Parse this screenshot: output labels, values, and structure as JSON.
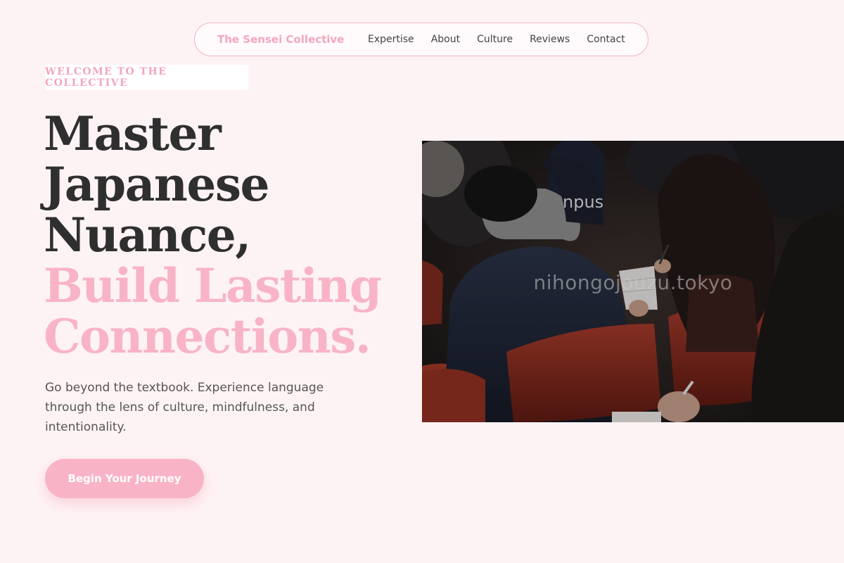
{
  "nav": {
    "brand": "The Sensei Collective",
    "links": [
      "Expertise",
      "About",
      "Culture",
      "Reviews",
      "Contact"
    ]
  },
  "hero": {
    "badge": "WELCOME TO THE COLLECTIVE",
    "headline_dark": [
      "Master",
      "Japanese",
      "Nuance,"
    ],
    "headline_pink": [
      "Build Lasting",
      "Connections."
    ],
    "subtext": "Go beyond the textbook. Experience language through the lens of culture, mindfulness, and intentionality.",
    "cta_label": "Begin Your Journey",
    "image": {
      "watermark": "nihongojouzu.tokyo",
      "sweatshirt_text": "npus"
    }
  },
  "colors": {
    "background": "#fef3f4",
    "accent_pink": "#f8b4c6",
    "brand_pink": "#f3a6bc",
    "heading_dark": "#2f2f2f",
    "body_text": "#555555"
  }
}
